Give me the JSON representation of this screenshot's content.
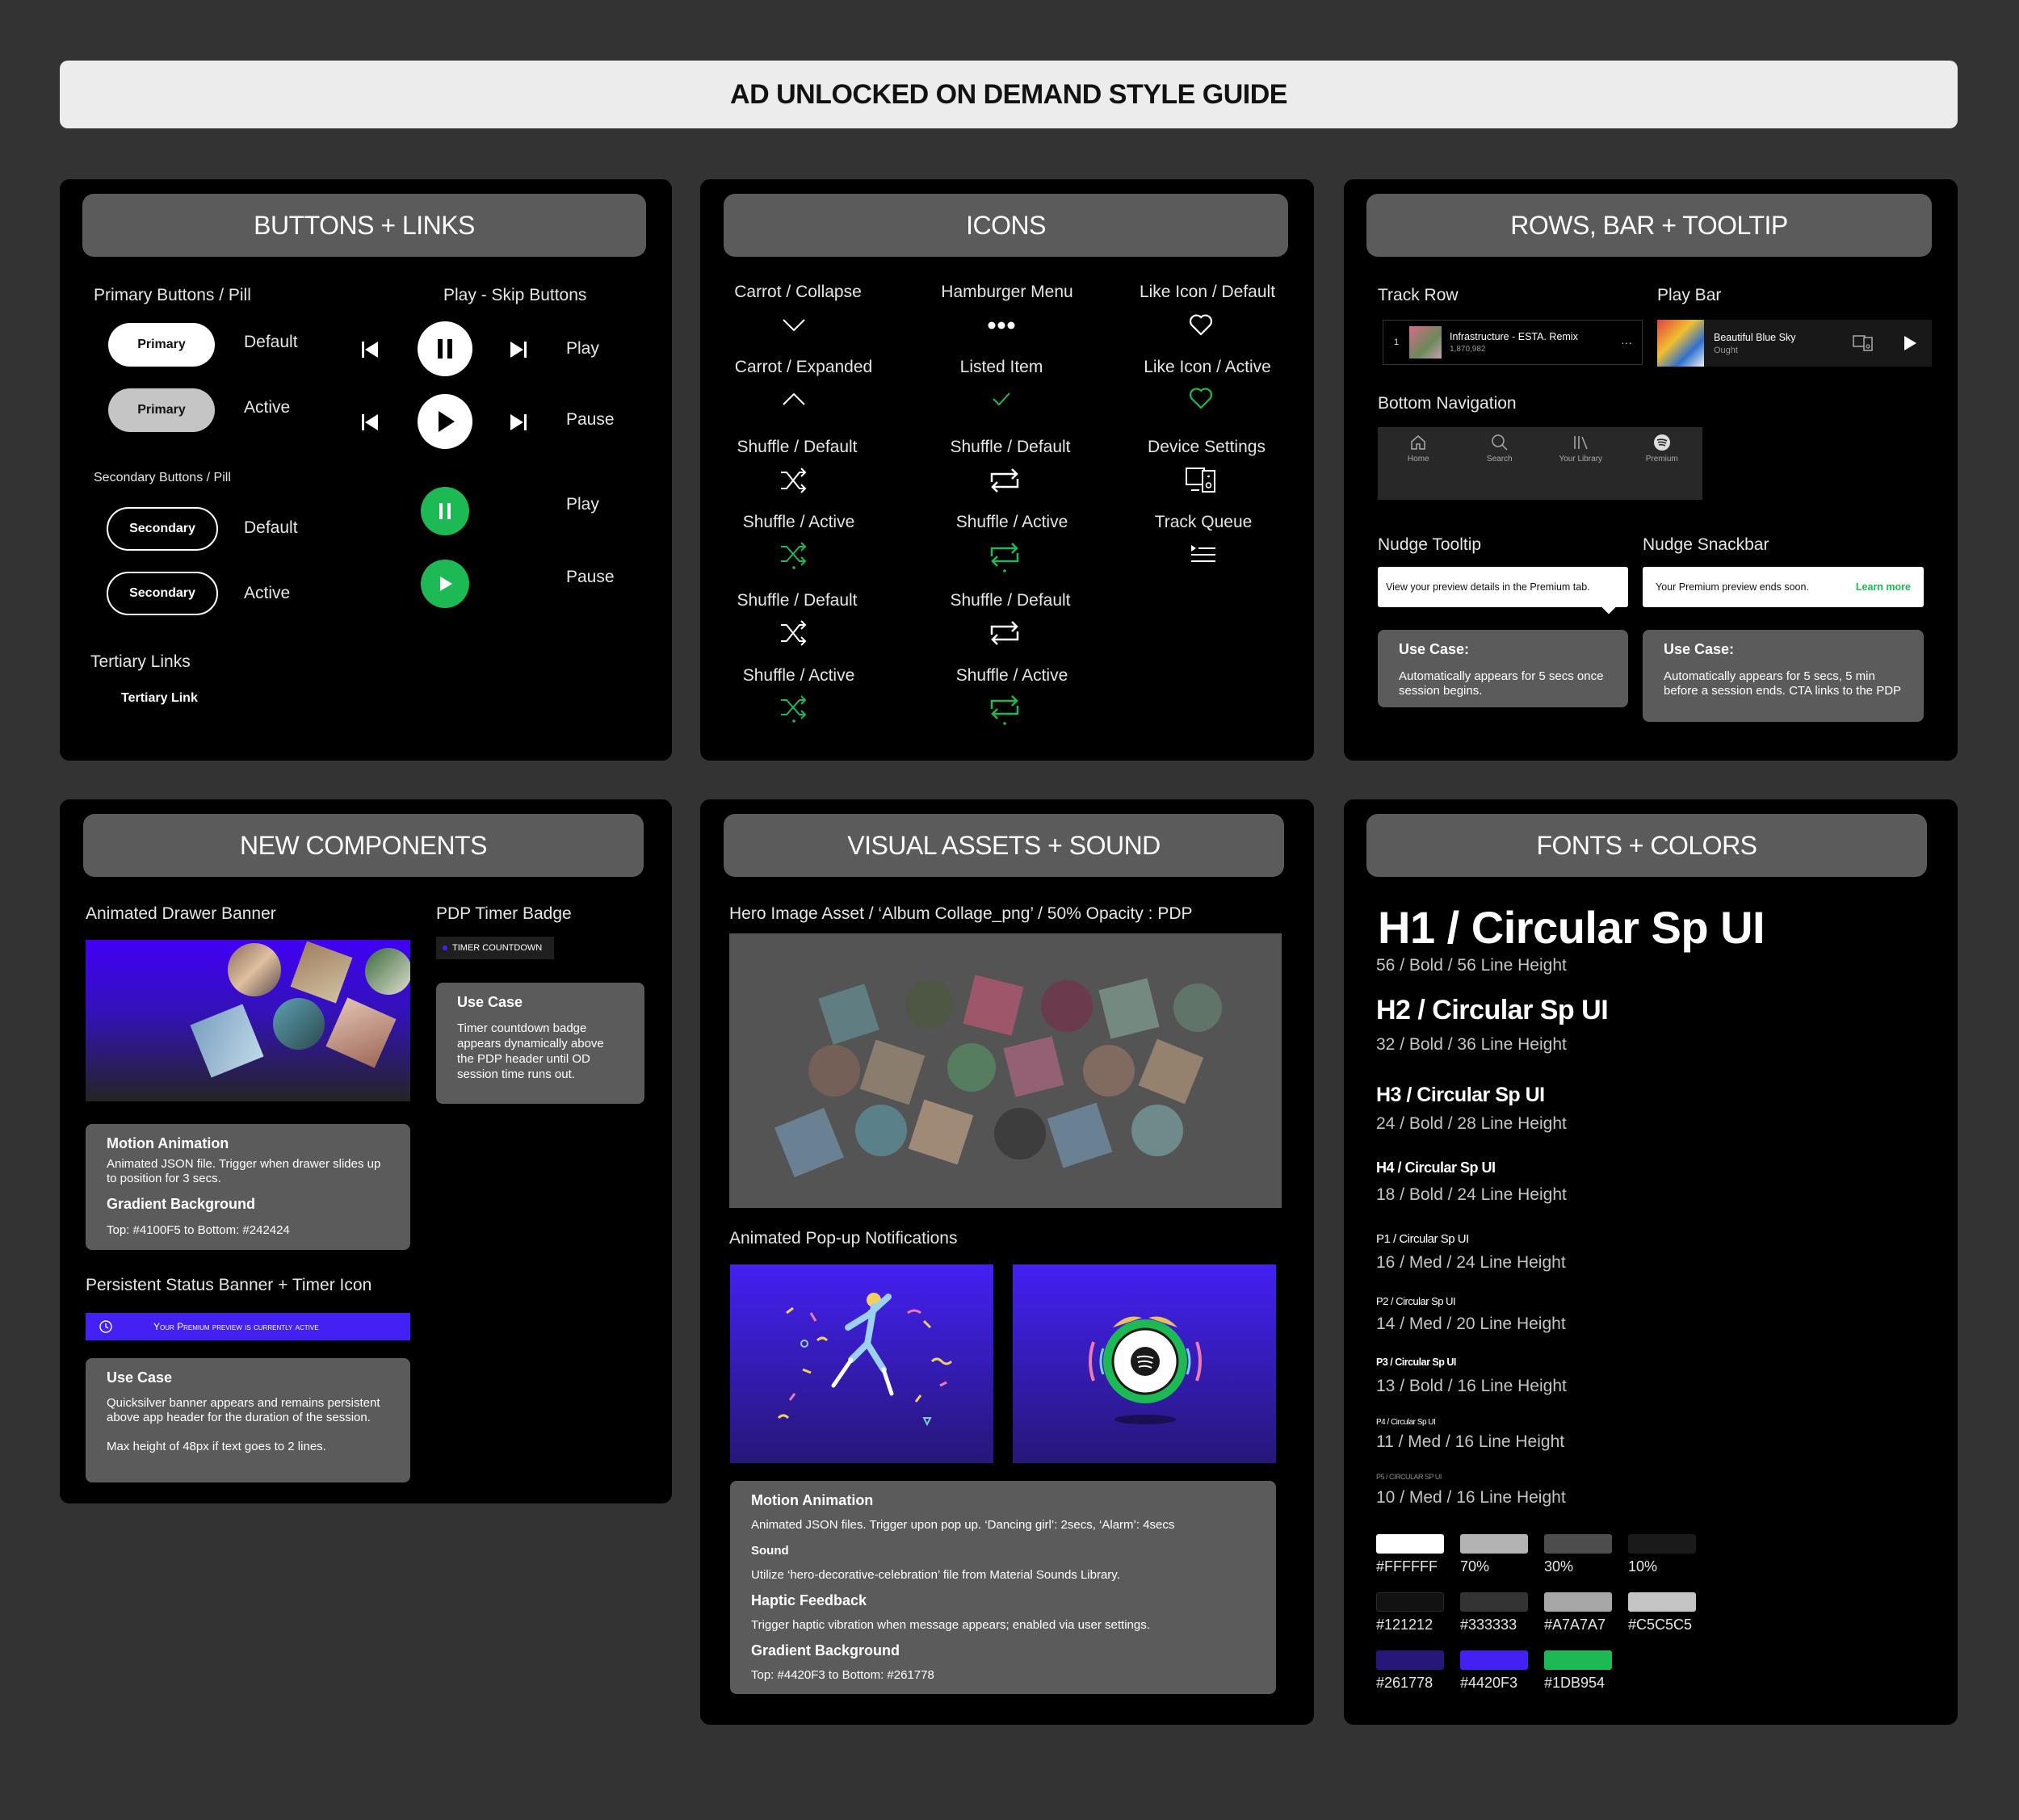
{
  "page_title": "AD UNLOCKED ON DEMAND STYLE GUIDE",
  "buttons": {
    "title": "BUTTONS + LINKS",
    "primary_label": "Primary Buttons / Pill",
    "primary": "Primary",
    "secondary_label": "Secondary Buttons / Pill",
    "secondary": "Secondary",
    "default": "Default",
    "active": "Active",
    "play_skip_label": "Play - Skip Buttons",
    "play": "Play",
    "pause": "Pause",
    "tertiary_label": "Tertiary Links",
    "tertiary": "Tertiary Link"
  },
  "icons": {
    "title": "ICONS",
    "carrot_collapse": "Carrot / Collapse",
    "carrot_expanded": "Carrot / Expanded",
    "hamburger": "Hamburger Menu",
    "listed_item": "Listed Item",
    "like_default": "Like Icon / Default",
    "like_active": "Like Icon / Active",
    "shuffle_default": "Shuffle / Default",
    "shuffle_active": "Shuffle / Active",
    "device_settings": "Device Settings",
    "track_queue": "Track Queue"
  },
  "rows": {
    "title": "ROWS, BAR + TOOLTIP",
    "track_row_label": "Track Row",
    "track_num": "1",
    "track_title": "Infrastructure - ESTA. Remix",
    "track_plays": "1,870,982",
    "track_menu": "···",
    "play_bar_label": "Play Bar",
    "bar_title": "Beautiful Blue Sky",
    "bar_artist": "Ought",
    "bottom_nav_label": "Bottom Navigation",
    "nav": [
      "Home",
      "Search",
      "Your Library",
      "Premium"
    ],
    "tooltip_label": "Nudge Tooltip",
    "tooltip_text": "View your preview details in the Premium tab.",
    "snackbar_label": "Nudge Snackbar",
    "snackbar_text": "Your Premium preview ends soon.",
    "snackbar_link": "Learn more",
    "usecase_title": "Use Case:",
    "usecase1": "Automatically appears for 5 secs once session begins.",
    "usecase2": "Automatically appears for 5 secs, 5 min before a session ends. CTA links to the PDP"
  },
  "newc": {
    "title": "NEW COMPONENTS",
    "drawer_label": "Animated Drawer Banner",
    "timer_label": "PDP Timer Badge",
    "timer_badge": "TIMER COUNTDOWN",
    "timer_card_title": "Use Case",
    "timer_card_text": "Timer countdown badge appears dynamically above the PDP header until OD session time runs out.",
    "motion_title": "Motion Animation",
    "motion_text": "Animated JSON file. Trigger when drawer slides up to position for 3 secs.",
    "grad_title": "Gradient Background",
    "grad_text": "Top: #4100F5 to Bottom: #242424",
    "status_label": "Persistent Status Banner + Timer Icon",
    "status_text": "Your Premium preview is currently active",
    "status_card_title": "Use Case",
    "status_card_text": "Quicksilver banner appears and remains persistent above app header for the duration of the session.",
    "status_card_text2": "Max height of 48px if text goes to 2 lines."
  },
  "visual": {
    "title": "VISUAL ASSETS + SOUND",
    "hero_label": "Hero Image Asset / ‘Album Collage_png’ / 50% Opacity : PDP",
    "popup_label": "Animated Pop-up Notifications",
    "motion_title": "Motion Animation",
    "motion_text": "Animated JSON files. Trigger upon pop up. ‘Dancing girl’: 2secs, ‘Alarm’: 4secs",
    "sound_title": "Sound",
    "sound_text": "Utilize ‘hero-decorative-celebration’ file from Material Sounds Library.",
    "haptic_title": "Haptic Feedback",
    "haptic_text": "Trigger haptic vibration when message appears; enabled via user settings.",
    "grad_title": "Gradient Background",
    "grad_text": "Top: #4420F3 to Bottom: #261778"
  },
  "fonts": {
    "title": "FONTS + COLORS",
    "styles": [
      {
        "name": "H1  /  Circular Sp UI",
        "spec": "56 / Bold / 56 Line Height"
      },
      {
        "name": "H2  / Circular Sp UI",
        "spec": "32 / Bold / 36 Line Height"
      },
      {
        "name": "H3  /  Circular Sp UI",
        "spec": "24 / Bold / 28 Line Height"
      },
      {
        "name": "H4  /  Circular Sp UI",
        "spec": "18 / Bold / 24 Line Height"
      },
      {
        "name": "P1  /  Circular Sp UI",
        "spec": "16 / Med / 24 Line Height"
      },
      {
        "name": "P2  /  Circular Sp UI",
        "spec": "14 / Med / 20 Line Height"
      },
      {
        "name": "P3  /  Circular Sp UI",
        "spec": "13 / Bold / 16 Line Height"
      },
      {
        "name": "P4  /  Circular Sp UI",
        "spec": "11 / Med / 16 Line Height"
      },
      {
        "name": "P5  /  CIRCULAR SP UI",
        "spec": "10 / Med / 16 Line Height"
      }
    ],
    "colors": [
      {
        "label": "#FFFFFF",
        "hex": "#FFFFFF"
      },
      {
        "label": "70%",
        "hex": "#B3B3B3"
      },
      {
        "label": "30%",
        "hex": "#4D4D4D"
      },
      {
        "label": "10%",
        "hex": "#1A1A1A"
      },
      {
        "label": "#121212",
        "hex": "#121212"
      },
      {
        "label": "#333333",
        "hex": "#333333"
      },
      {
        "label": "#A7A7A7",
        "hex": "#A7A7A7"
      },
      {
        "label": "#C5C5C5",
        "hex": "#C5C5C5"
      },
      {
        "label": "#261778",
        "hex": "#261778"
      },
      {
        "label": "#4420F3",
        "hex": "#4420F3"
      },
      {
        "label": "#1DB954",
        "hex": "#1DB954"
      }
    ]
  },
  "accent": "#1DB954"
}
